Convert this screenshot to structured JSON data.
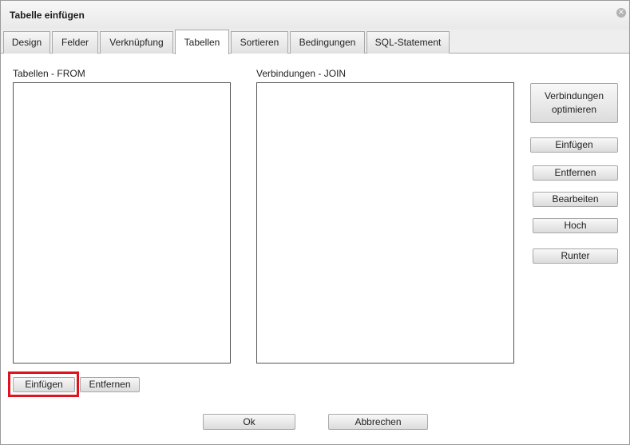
{
  "dialog": {
    "title": "Tabelle einfügen",
    "close_icon": "close-icon"
  },
  "tabs": [
    {
      "label": "Design",
      "active": false
    },
    {
      "label": "Felder",
      "active": false
    },
    {
      "label": "Verknüpfung",
      "active": false
    },
    {
      "label": "Tabellen",
      "active": true
    },
    {
      "label": "Sortieren",
      "active": false
    },
    {
      "label": "Bedingungen",
      "active": false
    },
    {
      "label": "SQL-Statement",
      "active": false
    }
  ],
  "from_panel": {
    "label": "Tabellen - FROM",
    "add_label": "Einfügen",
    "remove_label": "Entfernen"
  },
  "join_panel": {
    "label": "Verbindungen - JOIN",
    "optimize_label_line1": "Verbindungen",
    "optimize_label_line2": "optimieren",
    "add_label": "Einfügen",
    "remove_label": "Entfernen",
    "edit_label": "Bearbeiten",
    "up_label": "Hoch",
    "down_label": "Runter"
  },
  "footer": {
    "ok_label": "Ok",
    "cancel_label": "Abbrechen"
  },
  "colors": {
    "highlight": "#e0121e",
    "list_border": "#555555",
    "tab_border": "#a9a9a9"
  }
}
